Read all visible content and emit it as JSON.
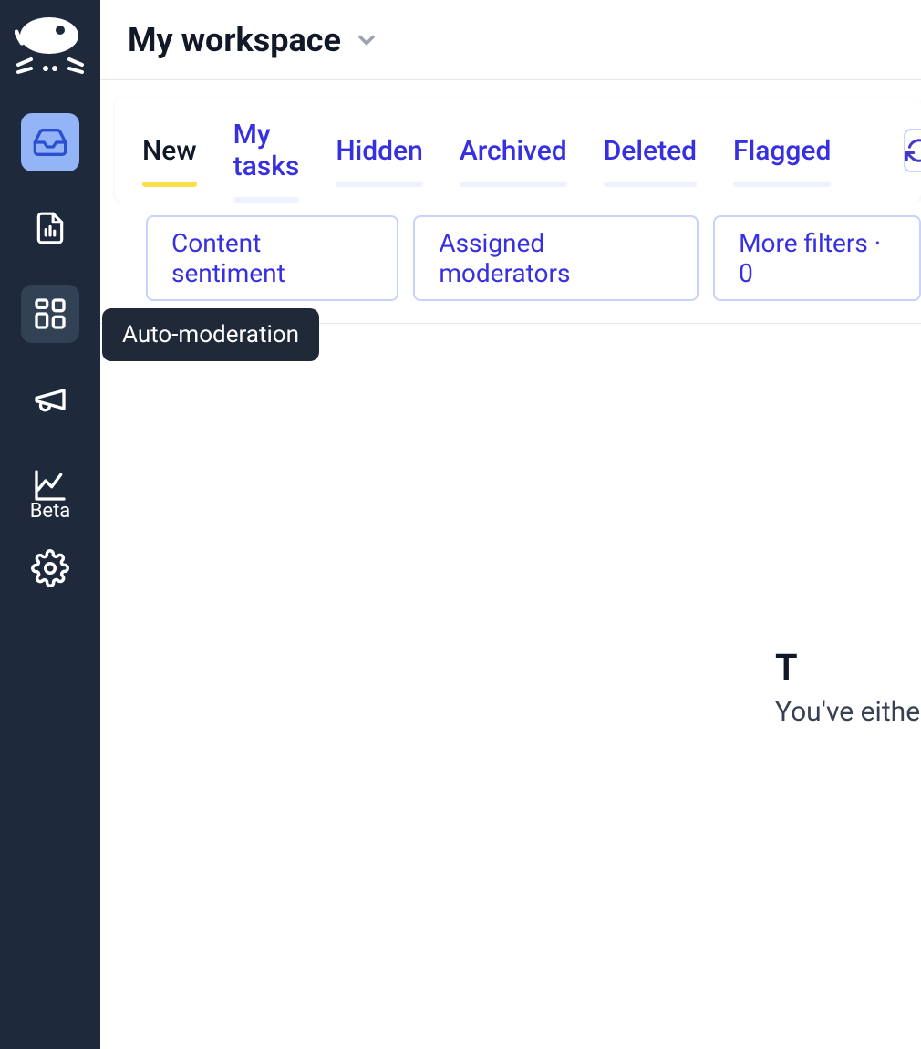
{
  "header": {
    "workspace_title": "My workspace"
  },
  "sidebar": {
    "items": [
      {
        "name": "inbox",
        "active": true
      },
      {
        "name": "reports",
        "active": false
      },
      {
        "name": "auto-moderation",
        "active": false,
        "hover": true
      },
      {
        "name": "announcements",
        "active": false
      },
      {
        "name": "analytics",
        "active": false,
        "label": "Beta"
      },
      {
        "name": "settings",
        "active": false
      }
    ],
    "beta_label": "Beta"
  },
  "tooltip": {
    "auto_moderation": "Auto-moderation"
  },
  "tabs": [
    {
      "label": "New",
      "active": true
    },
    {
      "label": "My tasks",
      "active": false
    },
    {
      "label": "Hidden",
      "active": false
    },
    {
      "label": "Archived",
      "active": false
    },
    {
      "label": "Deleted",
      "active": false
    },
    {
      "label": "Flagged",
      "active": false
    }
  ],
  "filters": {
    "content_sentiment": "Content sentiment",
    "assigned_moderators": "Assigned moderators",
    "more_filters": "More filters · 0"
  },
  "empty_state": {
    "title_visible": "T",
    "subtitle_visible": "You've either"
  }
}
